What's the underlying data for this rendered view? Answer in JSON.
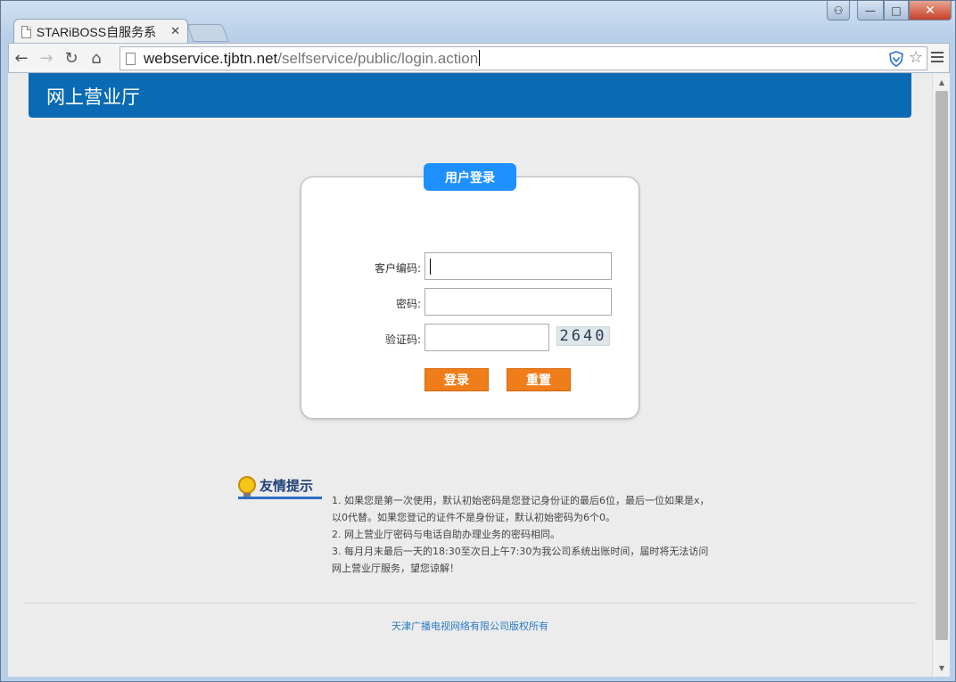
{
  "browser": {
    "tab_title": "STARiBOSS自服务系",
    "tab_close": "✕",
    "url_host": "webservice.tjbtn.net",
    "url_path": "/selfservice/public/login.action",
    "nav": {
      "back": "←",
      "forward": "→",
      "reload": "↻",
      "home": "⌂"
    },
    "window_buttons": {
      "user": "⚇",
      "minimize": "—",
      "maximize": "□",
      "close": "✕"
    },
    "star": "☆",
    "scroll": {
      "up": "▲",
      "down": "▼"
    }
  },
  "page": {
    "header_title": "网上营业厅",
    "login": {
      "tab_label": "用户登录",
      "customer_id_label": "客户编码:",
      "password_label": "密码:",
      "captcha_label": "验证码:",
      "captcha_text": "2640",
      "customer_id_value": "",
      "password_value": "",
      "captcha_value": "",
      "login_button": "登录",
      "reset_button": "重置"
    },
    "tips": {
      "title": "友情提示",
      "lines": [
        "1. 如果您是第一次使用，默认初始密码是您登记身份证的最后6位，最后一位如果是x，以0代替。如果您登记的证件不是身份证，默认初始密码为6个0。",
        "2. 网上营业厅密码与电话自助办理业务的密码相同。",
        "3. 每月月末最后一天的18:30至次日上午7:30为我公司系统出账时间，届时将无法访问网上营业厅服务，望您谅解！"
      ]
    },
    "footer": "天津广播电视网络有限公司版权所有"
  }
}
